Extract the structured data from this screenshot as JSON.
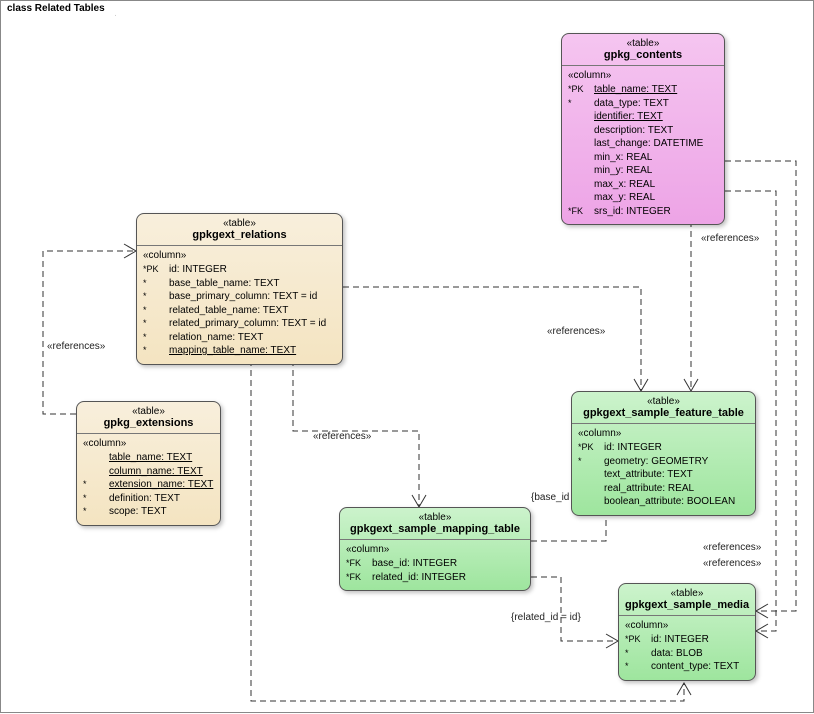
{
  "frame": {
    "title": "class Related Tables"
  },
  "stereo": {
    "table": "«table»",
    "column": "«column»",
    "references": "«references»"
  },
  "edges": {
    "base_id": "{base_id = id}",
    "related_id": "{related_id = id}"
  },
  "tables": {
    "gpkg_contents": {
      "name": "gpkg_contents",
      "columns": [
        {
          "key": "*PK",
          "name": "table_name: TEXT",
          "ul": true
        },
        {
          "key": "*",
          "name": "data_type: TEXT"
        },
        {
          "key": "",
          "name": "identifier: TEXT",
          "ul": true
        },
        {
          "key": "",
          "name": "description: TEXT"
        },
        {
          "key": "",
          "name": "last_change: DATETIME"
        },
        {
          "key": "",
          "name": "min_x: REAL"
        },
        {
          "key": "",
          "name": "min_y: REAL"
        },
        {
          "key": "",
          "name": "max_x: REAL"
        },
        {
          "key": "",
          "name": "max_y: REAL"
        },
        {
          "key": "*FK",
          "name": "srs_id: INTEGER"
        }
      ]
    },
    "gpkgext_relations": {
      "name": "gpkgext_relations",
      "columns": [
        {
          "key": "*PK",
          "name": "id: INTEGER"
        },
        {
          "key": "*",
          "name": "base_table_name: TEXT"
        },
        {
          "key": "*",
          "name": "base_primary_column: TEXT = id"
        },
        {
          "key": "*",
          "name": "related_table_name: TEXT"
        },
        {
          "key": "*",
          "name": "related_primary_column: TEXT = id"
        },
        {
          "key": "*",
          "name": "relation_name: TEXT"
        },
        {
          "key": "*",
          "name": "mapping_table_name: TEXT",
          "ul": true
        }
      ]
    },
    "gpkg_extensions": {
      "name": "gpkg_extensions",
      "columns": [
        {
          "key": "",
          "name": "table_name: TEXT",
          "ul": true
        },
        {
          "key": "",
          "name": "column_name: TEXT",
          "ul": true
        },
        {
          "key": "*",
          "name": "extension_name: TEXT",
          "ul": true
        },
        {
          "key": "*",
          "name": "definition: TEXT"
        },
        {
          "key": "*",
          "name": "scope: TEXT"
        }
      ]
    },
    "gpkgext_sample_feature_table": {
      "name": "gpkgext_sample_feature_table",
      "columns": [
        {
          "key": "*PK",
          "name": "id: INTEGER"
        },
        {
          "key": "*",
          "name": "geometry: GEOMETRY"
        },
        {
          "key": "",
          "name": "text_attribute: TEXT"
        },
        {
          "key": "",
          "name": "real_attribute: REAL"
        },
        {
          "key": "",
          "name": "boolean_attribute: BOOLEAN"
        }
      ]
    },
    "gpkgext_sample_mapping_table": {
      "name": "gpkgext_sample_mapping_table",
      "columns": [
        {
          "key": "*FK",
          "name": "base_id: INTEGER"
        },
        {
          "key": "*FK",
          "name": "related_id: INTEGER"
        }
      ]
    },
    "gpkgext_sample_media": {
      "name": "gpkgext_sample_media",
      "columns": [
        {
          "key": "*PK",
          "name": "id: INTEGER"
        },
        {
          "key": "*",
          "name": "data: BLOB"
        },
        {
          "key": "*",
          "name": "content_type: TEXT"
        }
      ]
    }
  }
}
